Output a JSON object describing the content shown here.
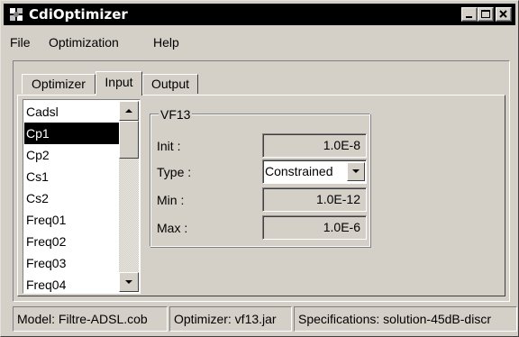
{
  "window": {
    "title": "CdiOptimizer",
    "controls": [
      "minimize-icon",
      "maximize-icon",
      "close-icon"
    ]
  },
  "menu": {
    "items": [
      "File",
      "Optimization",
      "Help"
    ]
  },
  "tabs": [
    {
      "label": "Optimizer",
      "active": false
    },
    {
      "label": "Input",
      "active": true
    },
    {
      "label": "Output",
      "active": false
    }
  ],
  "variables": {
    "items": [
      "Cadsl",
      "Cp1",
      "Cp2",
      "Cs1",
      "Cs2",
      "Freq01",
      "Freq02",
      "Freq03",
      "Freq04"
    ],
    "selected": "Cp1"
  },
  "parameter": {
    "name": "VF13",
    "init_label": "Init :",
    "init_value": "1.0E-8",
    "type_label": "Type :",
    "type_value": "Constrained",
    "min_label": "Min :",
    "min_value": "1.0E-12",
    "max_label": "Max :",
    "max_value": "1.0E-6"
  },
  "status": {
    "model": "Model: Filtre-ADSL.cob",
    "optimizer": "Optimizer: vf13.jar",
    "specifications": "Specifications: solution-45dB-discr"
  },
  "colors": {
    "title_bg": "#000000",
    "face": "#d4d0c8",
    "selection": "#000000"
  }
}
